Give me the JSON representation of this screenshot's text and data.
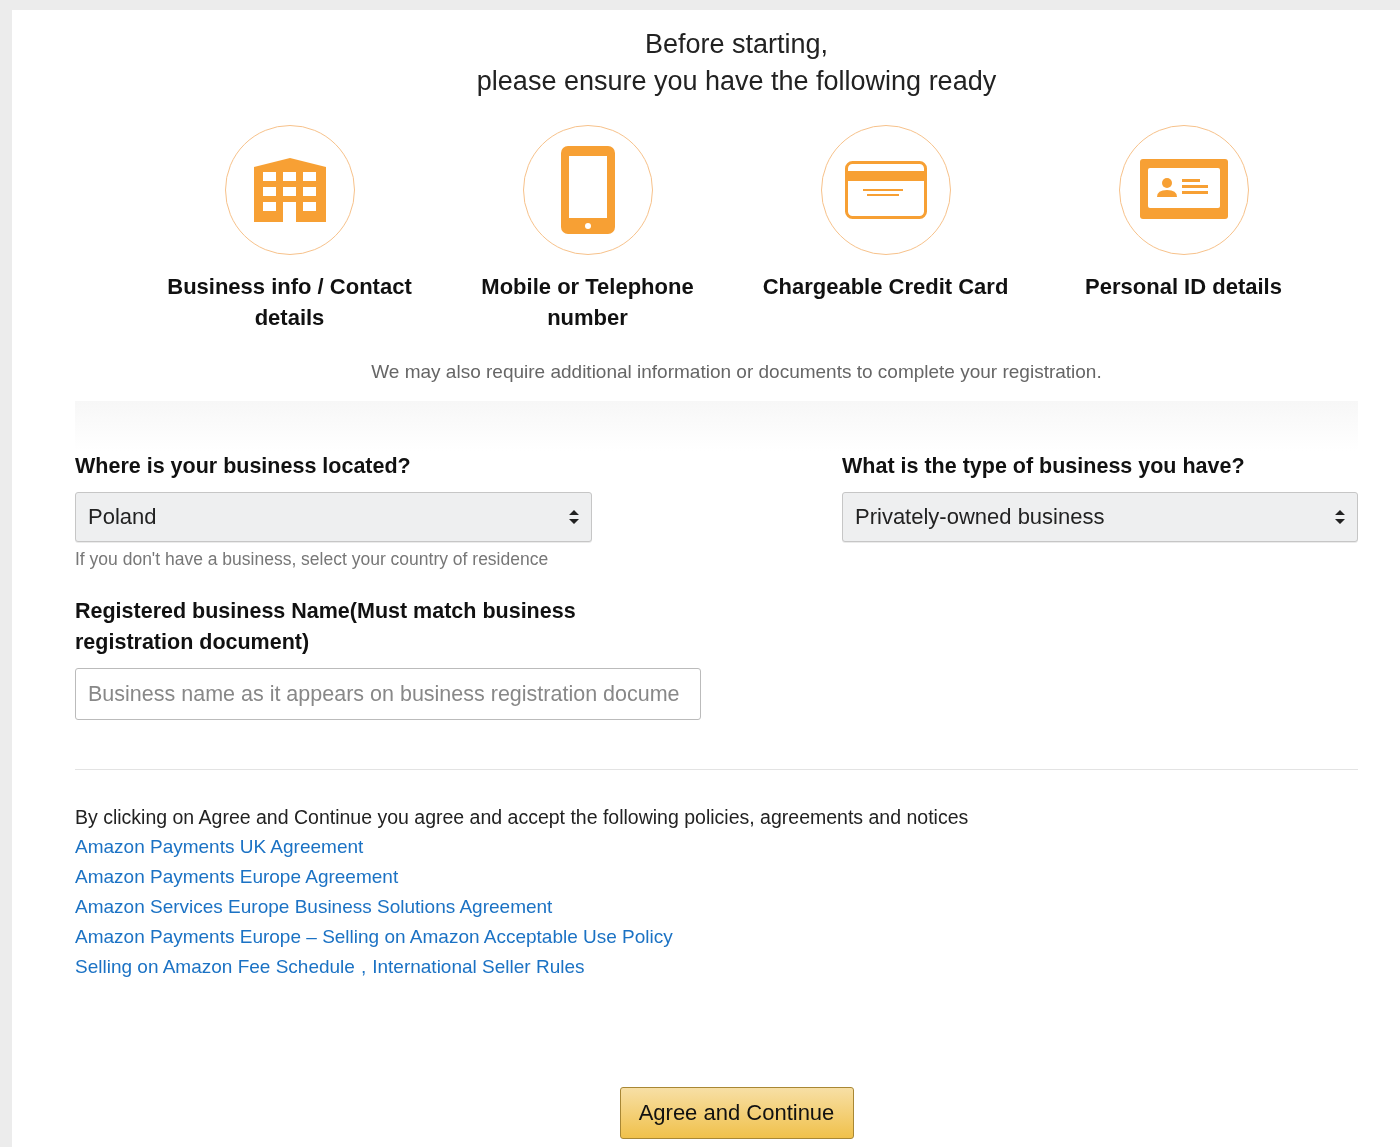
{
  "heading": {
    "line_1": "Before starting,",
    "line_2": "please ensure you have the following ready"
  },
  "requirements": [
    {
      "kind": "building",
      "label": "Business info / Contact details"
    },
    {
      "kind": "phone",
      "label": "Mobile or Telephone number"
    },
    {
      "kind": "card",
      "label": "Chargeable Credit Card"
    },
    {
      "kind": "id",
      "label": "Personal ID details"
    }
  ],
  "note": "We may also require additional information or documents to complete your registration.",
  "location": {
    "label": "Where is your business located?",
    "value": "Poland",
    "hint": "If you don't have a business, select your country of residence"
  },
  "business_type": {
    "label": "What is the type of business you have?",
    "value": "Privately-owned business"
  },
  "business_name": {
    "label": "Registered business Name(Must match business registration document)",
    "placeholder": "Business name as it appears on business registration docume"
  },
  "agreement": {
    "intro": "By clicking on Agree and Continue you agree and accept the following policies, agreements and notices",
    "lines": [
      {
        "links": [
          "Amazon Payments UK Agreement"
        ]
      },
      {
        "links": [
          "Amazon Payments Europe Agreement"
        ]
      },
      {
        "links": [
          "Amazon Services Europe Business Solutions Agreement"
        ]
      },
      {
        "links": [
          "Amazon Payments Europe – Selling on Amazon Acceptable Use Policy"
        ]
      },
      {
        "links": [
          "Selling on Amazon Fee Schedule",
          "International Seller Rules"
        ],
        "separator": ","
      }
    ]
  },
  "submit": "Agree and Continue"
}
